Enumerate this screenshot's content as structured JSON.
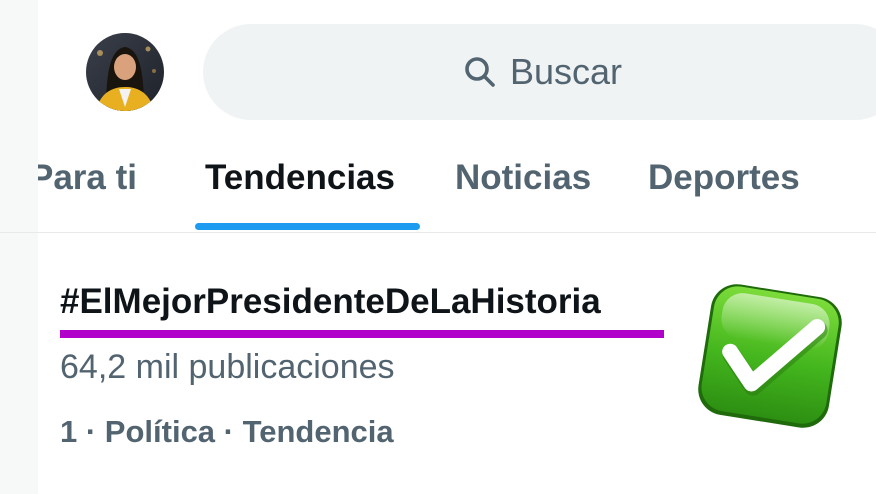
{
  "header": {
    "avatar_alt": "avatar",
    "search": {
      "placeholder": "Buscar"
    }
  },
  "tabs": [
    {
      "label": "Para ti",
      "active": false
    },
    {
      "label": "Tendencias",
      "active": true
    },
    {
      "label": "Noticias",
      "active": false
    },
    {
      "label": "Deportes",
      "active": false
    }
  ],
  "trend": {
    "name": "#ElMejorPresidenteDeLaHistoria",
    "count": "64,2 mil publicaciones",
    "meta": "1 · Política · Tendencia",
    "underline_color": "#b100c9",
    "emoji_icon": "check-mark-button-icon"
  },
  "colors": {
    "accent": "#1d9bf0",
    "secondary_text": "#536471",
    "primary_text": "#0f1419",
    "search_bg": "#eff3f4"
  }
}
